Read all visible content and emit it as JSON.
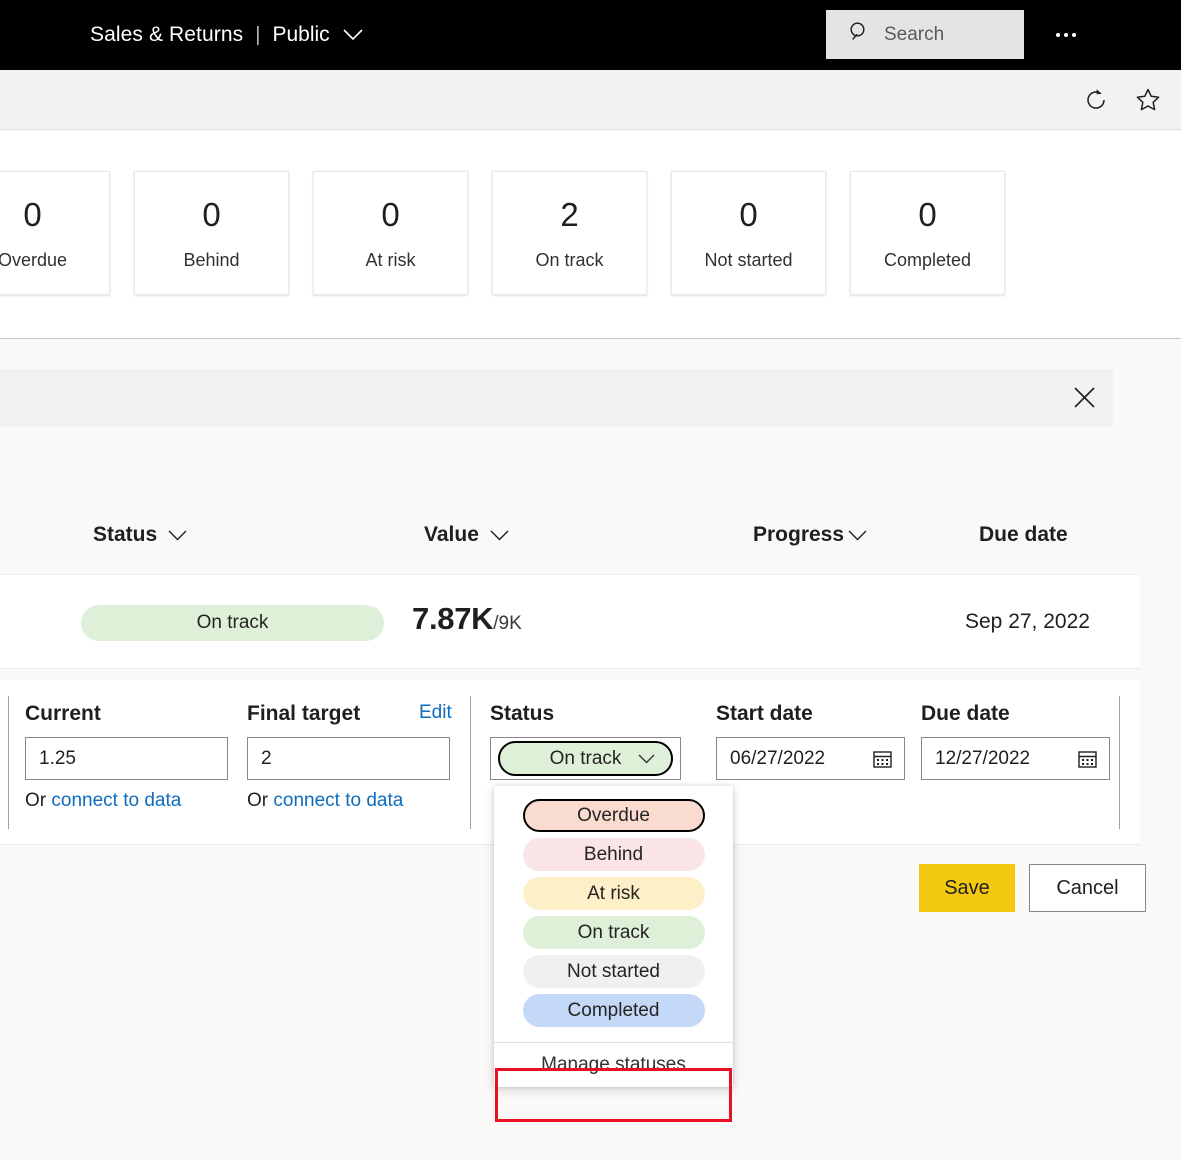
{
  "suite": {
    "app_title": "Sales & Returns",
    "separator": "|",
    "scope_label": "Public",
    "scope_chevron_icon": "chevron-down-icon",
    "search_placeholder": "Search",
    "search_value": "",
    "search_icon": "search-icon",
    "more_icon": "ellipsis-icon"
  },
  "command_bar": {
    "refresh_icon": "refresh-icon",
    "favorite_icon": "star-icon"
  },
  "kpi_cards": [
    {
      "value": "0",
      "label": "Overdue"
    },
    {
      "value": "0",
      "label": "Behind"
    },
    {
      "value": "0",
      "label": "At risk"
    },
    {
      "value": "2",
      "label": "On track"
    },
    {
      "value": "0",
      "label": "Not started"
    },
    {
      "value": "0",
      "label": "Completed"
    }
  ],
  "panel": {
    "close_icon": "close-icon"
  },
  "columns": {
    "status": "Status",
    "status_chevron_icon": "chevron-down-icon",
    "value": "Value",
    "value_chevron_icon": "chevron-down-icon",
    "progress": "Progress",
    "progress_chevron_icon": "chevron-down-icon",
    "due_date": "Due date"
  },
  "goal_row": {
    "status_label": "On track",
    "status_color": "#dff0d8",
    "value_main": "7.87K",
    "value_sub": "/9K",
    "due_date": "Sep 27, 2022"
  },
  "edit_form": {
    "current": {
      "label": "Current",
      "value": "1.25",
      "connect_prefix": "Or ",
      "connect_link": "connect to data"
    },
    "final_target": {
      "label": "Final target",
      "value": "2",
      "connect_prefix": "Or ",
      "connect_link": "connect to data"
    },
    "edit_link": "Edit",
    "status": {
      "label": "Status",
      "selected": "On track",
      "selected_color": "#dff0d8",
      "caret_icon": "chevron-down-icon"
    },
    "start_date": {
      "label": "Start date",
      "value": "06/27/2022",
      "calendar_icon": "calendar-icon"
    },
    "due_date": {
      "label": "Due date",
      "value": "12/27/2022",
      "calendar_icon": "calendar-icon"
    },
    "save_label": "Save",
    "cancel_label": "Cancel",
    "save_color": "#f2c811"
  },
  "status_dropdown": {
    "options": [
      {
        "label": "Overdue",
        "color": "#fadbd0",
        "focused": true
      },
      {
        "label": "Behind",
        "color": "#fbe4e6",
        "focused": false
      },
      {
        "label": "At risk",
        "color": "#fdefc8",
        "focused": false
      },
      {
        "label": "On track",
        "color": "#dff0d8",
        "focused": false
      },
      {
        "label": "Not started",
        "color": "#f0f0f0",
        "focused": false
      },
      {
        "label": "Completed",
        "color": "#c3d9f7",
        "focused": false
      }
    ],
    "manage_label": "Manage statuses",
    "highlight_color": "#e81123"
  }
}
